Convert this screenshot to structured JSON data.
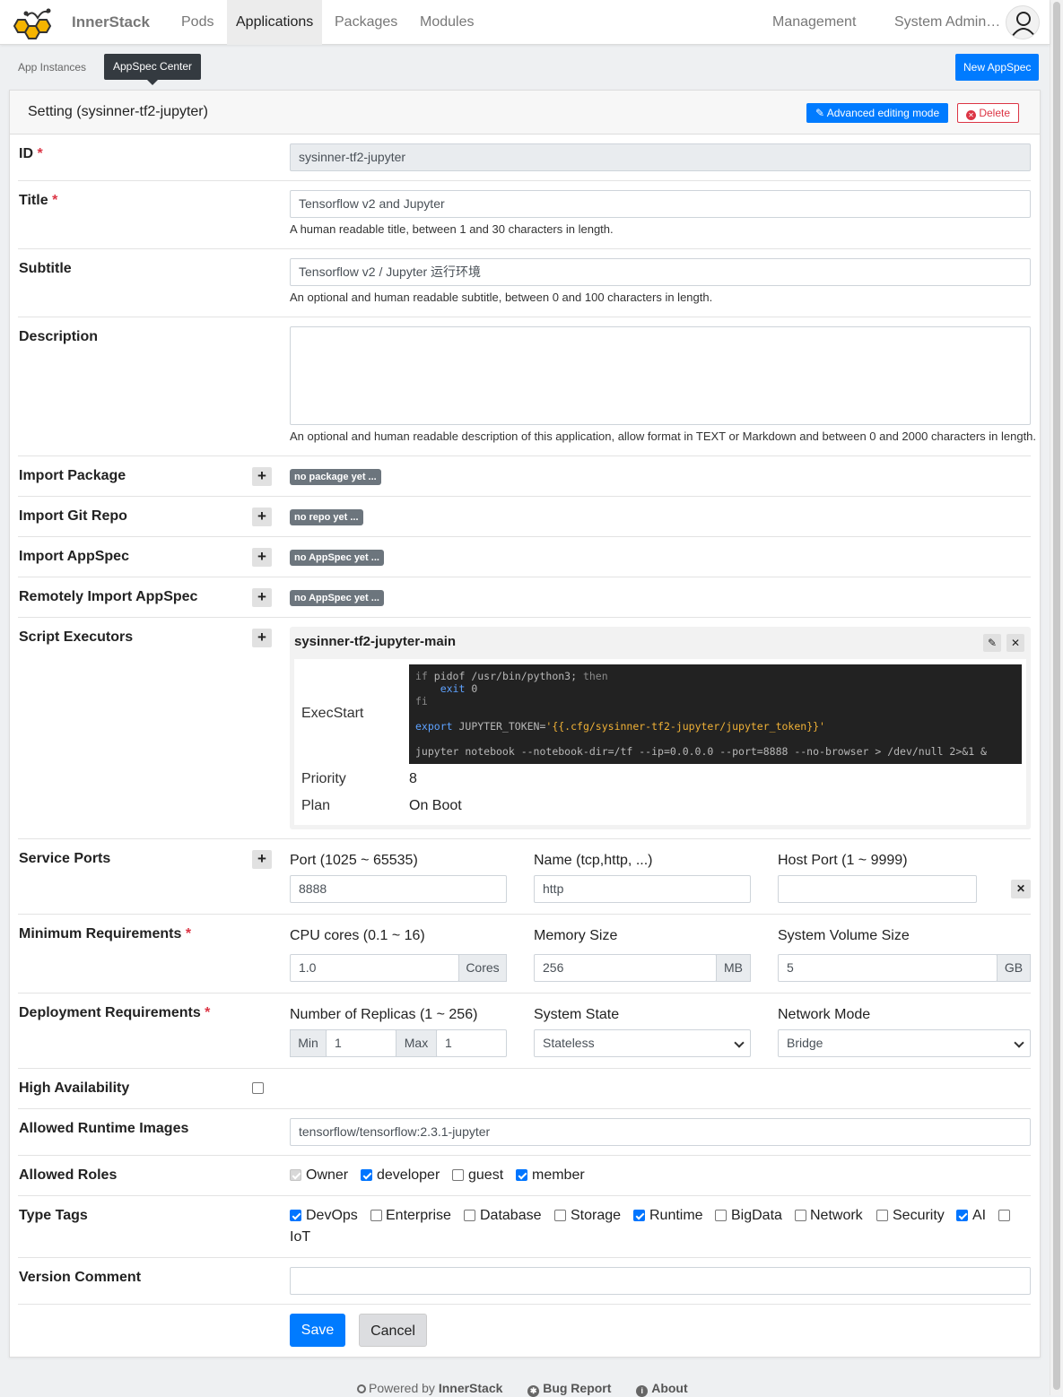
{
  "nav": {
    "brand": "InnerStack",
    "items": [
      "Pods",
      "Applications",
      "Packages",
      "Modules"
    ],
    "management": "Management",
    "user": "System Admin…"
  },
  "subnav": {
    "app_instances": "App Instances",
    "appspec_center": "AppSpec Center",
    "new_appspec": "New AppSpec"
  },
  "card": {
    "title": "Setting (sysinner-tf2-jupyter)",
    "advanced_btn": "Advanced editing mode",
    "delete_btn": "Delete"
  },
  "form": {
    "id": {
      "label": "ID",
      "value": "sysinner-tf2-jupyter"
    },
    "title": {
      "label": "Title",
      "value": "Tensorflow v2 and Jupyter",
      "help": "A human readable title, between 1 and 30 characters in length."
    },
    "subtitle": {
      "label": "Subtitle",
      "value": "Tensorflow v2 / Jupyter 运行环境",
      "help": "An optional and human readable subtitle, between 0 and 100 characters in length."
    },
    "description": {
      "label": "Description",
      "value": "",
      "help": "An optional and human readable description of this application, allow format in TEXT or Markdown and between 0 and 2000 characters in length."
    },
    "import_package": {
      "label": "Import Package",
      "badge": "no package yet ..."
    },
    "import_git": {
      "label": "Import Git Repo",
      "badge": "no repo yet ..."
    },
    "import_appspec": {
      "label": "Import AppSpec",
      "badge": "no AppSpec yet ..."
    },
    "remote_import": {
      "label": "Remotely Import AppSpec",
      "badge": "no AppSpec yet ..."
    },
    "script_executors": {
      "label": "Script Executors",
      "name": "sysinner-tf2-jupyter-main",
      "execstart_label": "ExecStart",
      "priority_label": "Priority",
      "priority": "8",
      "plan_label": "Plan",
      "plan": "On Boot",
      "code": {
        "l1a": "if",
        "l1b": " pidof /usr/bin/python3; ",
        "l1c": "then",
        "l2a": "    ",
        "l2b": "exit",
        "l2c": " 0",
        "l3": "fi",
        "l5a": "export",
        "l5b": " JUPYTER_TOKEN=",
        "l5c": "'{{.cfg/sysinner-tf2-jupyter/jupyter_token}}'",
        "l7": "jupyter notebook --notebook-dir=/tf --ip=0.0.0.0 --port=8888 --no-browser > /dev/null 2>&1 &"
      }
    },
    "service_ports": {
      "label": "Service Ports",
      "port_label": "Port (1025 ~ 65535)",
      "port": "8888",
      "name_label": "Name (tcp,http, ...)",
      "name": "http",
      "host_label": "Host Port (1 ~ 9999)",
      "host": ""
    },
    "min_req": {
      "label": "Minimum Requirements",
      "cpu_label": "CPU cores (0.1 ~ 16)",
      "cpu": "1.0",
      "cpu_unit": "Cores",
      "mem_label": "Memory Size",
      "mem": "256",
      "mem_unit": "MB",
      "vol_label": "System Volume Size",
      "vol": "5",
      "vol_unit": "GB"
    },
    "deploy_req": {
      "label": "Deployment Requirements",
      "replicas_label": "Number of Replicas (1 ~ 256)",
      "min_addon": "Min",
      "min": "1",
      "max_addon": "Max",
      "max": "1",
      "state_label": "System State",
      "state": "Stateless",
      "network_label": "Network Mode",
      "network": "Bridge"
    },
    "high_availability": {
      "label": "High Availability",
      "checked": false
    },
    "runtime_images": {
      "label": "Allowed Runtime Images",
      "value": "tensorflow/tensorflow:2.3.1-jupyter"
    },
    "roles": {
      "label": "Allowed Roles",
      "items": [
        {
          "name": "Owner",
          "checked": true
        },
        {
          "name": "developer",
          "checked": true
        },
        {
          "name": "guest",
          "checked": false
        },
        {
          "name": "member",
          "checked": true
        }
      ]
    },
    "type_tags": {
      "label": "Type Tags",
      "items": [
        {
          "name": "DevOps",
          "checked": true
        },
        {
          "name": "Enterprise",
          "checked": false
        },
        {
          "name": "Database",
          "checked": false
        },
        {
          "name": "Storage",
          "checked": false
        },
        {
          "name": "Runtime",
          "checked": true
        },
        {
          "name": "BigData",
          "checked": false
        },
        {
          "name": "Network",
          "checked": false
        },
        {
          "name": "Security",
          "checked": false
        },
        {
          "name": "AI",
          "checked": true
        },
        {
          "name": "IoT",
          "checked": false
        }
      ]
    },
    "version_comment": {
      "label": "Version Comment",
      "value": ""
    },
    "save": "Save",
    "cancel": "Cancel"
  },
  "footer": {
    "powered": "Powered by",
    "brand": "InnerStack",
    "bug": "Bug Report",
    "about": "About"
  },
  "colors": {
    "primary": "#007bff",
    "danger": "#dc3545",
    "badge": "#6c757d",
    "logo": "#f5b400"
  }
}
